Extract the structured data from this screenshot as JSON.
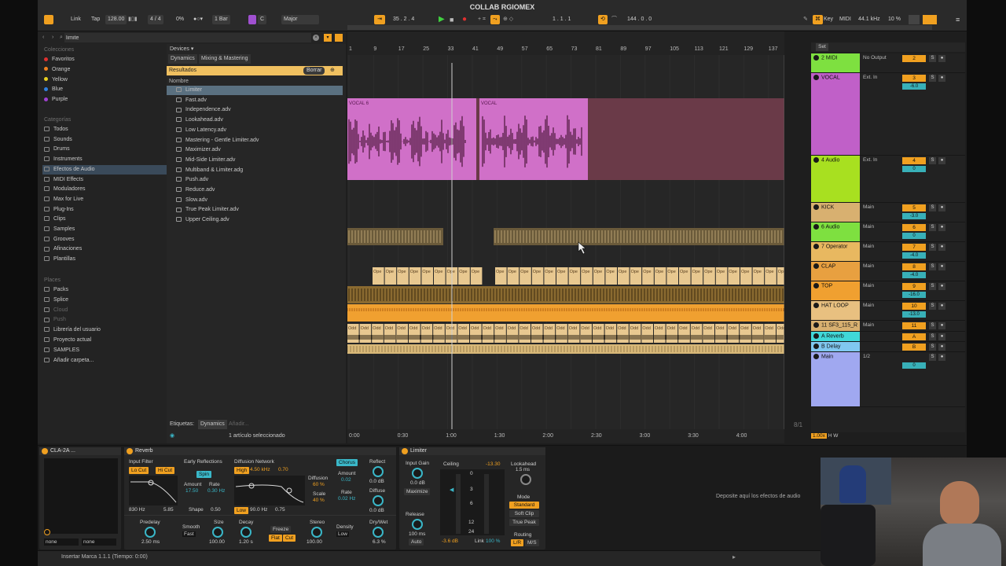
{
  "window_title": "COLLAB RGIOMEX",
  "topbar": {
    "link": "Link",
    "tap": "Tap",
    "tempo": "128.00",
    "sig": "4 / 4",
    "cpu": "0%",
    "quant": "1 Bar",
    "key": "C",
    "scale": "Major",
    "position": "35 .  2 .  4",
    "loop_start": "1 .  1 .  1",
    "loop_len": "144 .  0 .  0",
    "key_label": "Key",
    "midi_label": "MIDI",
    "rate": "44.1 kHz",
    "load": "10 %"
  },
  "browser": {
    "search": "limite",
    "collections_header": "Colecciones",
    "collections": [
      {
        "label": "Favoritos",
        "color": "#e03030"
      },
      {
        "label": "Orange",
        "color": "#f08020"
      },
      {
        "label": "Yellow",
        "color": "#e8d020"
      },
      {
        "label": "Blue",
        "color": "#3080e0"
      },
      {
        "label": "Purple",
        "color": "#a040d0"
      }
    ],
    "categories_header": "Categorías",
    "categories": [
      "Todos",
      "Sounds",
      "Drums",
      "Instruments",
      "Efectos de Audio",
      "MIDI Effects",
      "Moduladores",
      "Max for Live",
      "Plug-Ins",
      "Clips",
      "Samples",
      "Grooves",
      "Afinaciones",
      "Plantillas"
    ],
    "places_header": "Places",
    "places": [
      "Packs",
      "Splice",
      "Cloud",
      "Push",
      "Librería del usuario",
      "Proyecto actual",
      "SAMPLES",
      "Añadir carpeta..."
    ],
    "devices_label": "Devices ▾",
    "breadcrumb": [
      "Dynamics",
      "Mixing & Mastering"
    ],
    "results_label": "Resultados",
    "clear_label": "Borrar",
    "name_header": "Nombre",
    "files": [
      "Limiter",
      "Fast.adv",
      "Independence.adv",
      "Lookahead.adv",
      "Low Latency.adv",
      "Mastering - Gentle Limiter.adv",
      "Maximizer.adv",
      "Mid-Side Limiter.adv",
      "Multiband & Limiter.adg",
      "Push.adv",
      "Reduce.adv",
      "Slow.adv",
      "True Peak Limiter.adv",
      "Upper Ceiling.adv"
    ],
    "tags_label": "Etiquetas:",
    "tag": "Dynamics",
    "tag_add": "Añadir...",
    "selected_info": "1 artículo seleccionado"
  },
  "ruler": [
    "1",
    "9",
    "17",
    "25",
    "33",
    "41",
    "49",
    "57",
    "65",
    "73",
    "81",
    "89",
    "97",
    "105",
    "113",
    "121",
    "129",
    "137",
    "145"
  ],
  "time_ruler": [
    "0:00",
    "0:30",
    "1:00",
    "1:30",
    "2:00",
    "2:30",
    "3:00",
    "3:30",
    "4:00",
    "4:30"
  ],
  "clips": {
    "vocal_a": "VOCAL 6",
    "vocal_b": "VOCAL",
    "operator": "Ope",
    "odd": "Odd"
  },
  "mixer": {
    "set_label": "Set",
    "tracks": [
      {
        "name": "2 MIDI",
        "io": "No Output",
        "num": "2",
        "color": "#7ee040"
      },
      {
        "name": "VOCAL",
        "io": "Ext. In",
        "num": "3",
        "vol": "-6.0",
        "color": "#c060c8"
      },
      {
        "name": "4 Audio",
        "io": "Ext. In",
        "num": "4",
        "vol": "0",
        "color": "#a8e020"
      },
      {
        "name": "KICK",
        "io": "Main",
        "num": "5",
        "vol": "-3.0",
        "color": "#d8b070"
      },
      {
        "name": "6 Audio",
        "io": "Main",
        "num": "6",
        "vol": "0",
        "color": "#7ee040"
      },
      {
        "name": "7 Operator",
        "io": "Main",
        "num": "7",
        "vol": "-4.0",
        "color": "#e8b860"
      },
      {
        "name": "CLAP",
        "io": "Main",
        "num": "8",
        "vol": "-4.0",
        "color": "#e8a040"
      },
      {
        "name": "TOP",
        "io": "Main",
        "num": "9",
        "vol": "-16.0",
        "color": "#f0a030"
      },
      {
        "name": "HAT LOOP",
        "io": "Main",
        "num": "10",
        "vol": "-13.0",
        "color": "#e8c080"
      },
      {
        "name": "11 SF3_115_R",
        "io": "Main",
        "num": "11",
        "vol": "",
        "color": "#d8b070"
      },
      {
        "name": "A Reverb",
        "io": "",
        "num": "A",
        "vol": "",
        "color": "#40d8d8"
      },
      {
        "name": "B Delay",
        "io": "",
        "num": "B",
        "vol": "",
        "color": "#80c8f0"
      },
      {
        "name": "Main",
        "io": "1/2",
        "num": "",
        "vol": "0",
        "color": "#a0a8f0"
      }
    ],
    "in_label": "In",
    "auto_label": "Auto",
    "off_label": "Off",
    "post_label": "Post",
    "zoom": "1.00x",
    "counter": "8/1"
  },
  "devices": {
    "cla_title": "CLA-2A ...",
    "none_a": "none",
    "none_b": "none",
    "reverb": {
      "title": "Reverb",
      "input_filter": "Input Filter",
      "lo_cut": "Lo Cut",
      "hi_cut": "Hi Cut",
      "freq_lo": "830 Hz",
      "freq_hi": "5.85",
      "early": "Early Reflections",
      "spin": "Spin",
      "amount_label": "Amount",
      "rate_label": "Rate",
      "amount": "17.50",
      "rate": "0.30 Hz",
      "shape_label": "Shape",
      "shape": "0.50",
      "diffusion_net": "Diffusion Network",
      "high": "High",
      "high_freq": "4.50 kHz",
      "high_val": "0.70",
      "low": "Low",
      "low_freq": "90.0 Hz",
      "low_val": "0.75",
      "diffusion_label": "Diffusion",
      "diffusion": "60 %",
      "scale_label": "Scale",
      "scale": "40 %",
      "chorus": "Chorus",
      "ch_amount_label": "Amount",
      "ch_amount": "0.02",
      "ch_rate_label": "Rate",
      "ch_rate": "0.02 Hz",
      "reflect_label": "Reflect",
      "reflect": "0.0 dB",
      "diffuse_label": "Diffuse",
      "diffuse": "0.0 dB",
      "predelay_label": "Predelay",
      "predelay": "2.50 ms",
      "smooth_label": "Smooth",
      "smooth": "Fast",
      "size_label": "Size",
      "size": "100.00",
      "decay_label": "Decay",
      "decay": "1.20 s",
      "freeze": "Freeze",
      "flat": "Flat",
      "cut": "Cut",
      "stereo_label": "Stereo",
      "stereo": "100.00",
      "density_label": "Density",
      "density": "Low",
      "drywet_label": "Dry/Wet",
      "drywet": "6.3 %"
    },
    "limiter": {
      "title": "Limiter",
      "input_gain_label": "Input Gain",
      "input_gain": "0.0 dB",
      "maximize": "Maximize",
      "ceiling_label": "Ceiling",
      "ceiling": "-13.30",
      "meter_ticks": [
        "0",
        "3",
        "6",
        "12",
        "24"
      ],
      "release_label": "Release",
      "release": "100 ms",
      "auto": "Auto",
      "gr": "-3.6 dB",
      "link_label": "Link",
      "link": "100 %",
      "lookahead_label": "Lookahead",
      "lookahead": "1.5 ms",
      "mode_label": "Mode",
      "mode_standard": "Standard",
      "mode_soft": "Soft Clip",
      "mode_true": "True Peak",
      "routing_label": "Routing",
      "lr": "L/R",
      "ms": "M/S"
    },
    "drop_hint": "Deposite aquí los efectos de audio"
  },
  "status": "Insertar Marca 1.1.1 (Tiempo: 0:00)"
}
